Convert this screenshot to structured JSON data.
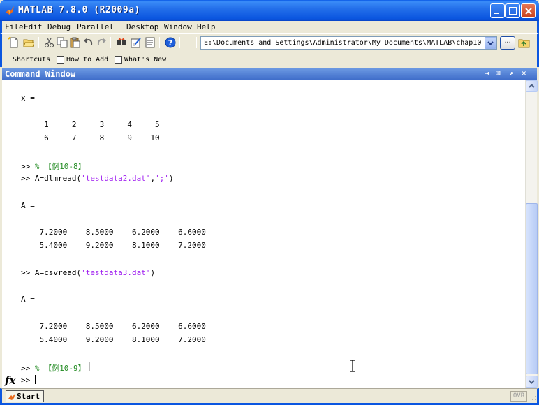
{
  "window": {
    "title": "MATLAB  7.8.0 (R2009a)"
  },
  "menu": [
    "File",
    "Edit",
    "Debug",
    "Parallel",
    "Desktop",
    "Window",
    "Help"
  ],
  "toolbar": {
    "current_folder": "E:\\Documents and Settings\\Administrator\\My Documents\\MATLAB\\chap10",
    "browse_label": "..."
  },
  "shortcuts": {
    "label": "Shortcuts",
    "items": [
      "How to Add",
      "What's New"
    ]
  },
  "command_window": {
    "title": "Command Window",
    "output": {
      "x_label": "x =",
      "x_row1": "     1     2     3     4     5",
      "x_row2": "     6     7     8     9    10",
      "prompt1": ">> ",
      "comment1": "% 【例10-8】",
      "cmd2_prefix": ">> A=dlmread(",
      "cmd2_str1": "'testdata2.dat'",
      "cmd2_comma": ",",
      "cmd2_str2": "';'",
      "cmd2_suffix": ")",
      "a_label1": "A =",
      "a1_row1": "    7.2000    8.5000    6.2000    6.6000",
      "a1_row2": "    5.4000    9.2000    8.1000    7.2000",
      "cmd3_prefix": ">> A=csvread(",
      "cmd3_str": "'testdata3.dat'",
      "cmd3_suffix": ")",
      "a_label2": "A =",
      "a2_row1": "    7.2000    8.5000    6.2000    6.6000",
      "a2_row2": "    5.4000    9.2000    8.1000    7.2000",
      "prompt4": ">> ",
      "comment4": "% 【例10-9】",
      "prompt5": ">> "
    },
    "fx_label": "fx"
  },
  "statusbar": {
    "start_label": "Start",
    "ovr_label": "OVR"
  },
  "colors": {
    "title_blue": "#0b56e0",
    "string_purple": "#a020f0",
    "comment_green": "#228b22"
  }
}
